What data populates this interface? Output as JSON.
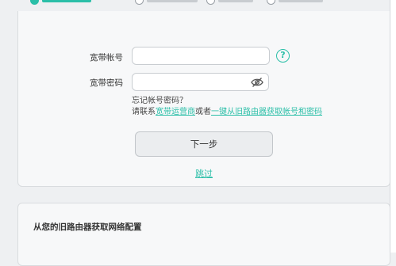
{
  "steps": [
    {
      "label": "step-1",
      "active": true
    },
    {
      "label": "step-2",
      "active": false
    },
    {
      "label": "step-3",
      "active": false
    },
    {
      "label": "step-4",
      "active": false
    }
  ],
  "form": {
    "account_label": "宽带帐号",
    "account_value": "",
    "password_label": "宽带密码",
    "password_value": "",
    "forgot_text": "忘记帐号密码？",
    "contact_prefix": "请联系",
    "contact_link": "宽带运营商",
    "contact_or": "或者",
    "import_link": "一键从旧路由器获取帐号和密码",
    "next_button": "下一步",
    "skip_link": "跳过"
  },
  "section2": {
    "title": "从您的旧路由器获取网络配置"
  },
  "colors": {
    "accent": "#2bbfa8",
    "background": "#eef0f2",
    "card": "#f7f8f9"
  },
  "icons": {
    "help": "question-circle-icon",
    "password_toggle": "eye-off-icon"
  }
}
